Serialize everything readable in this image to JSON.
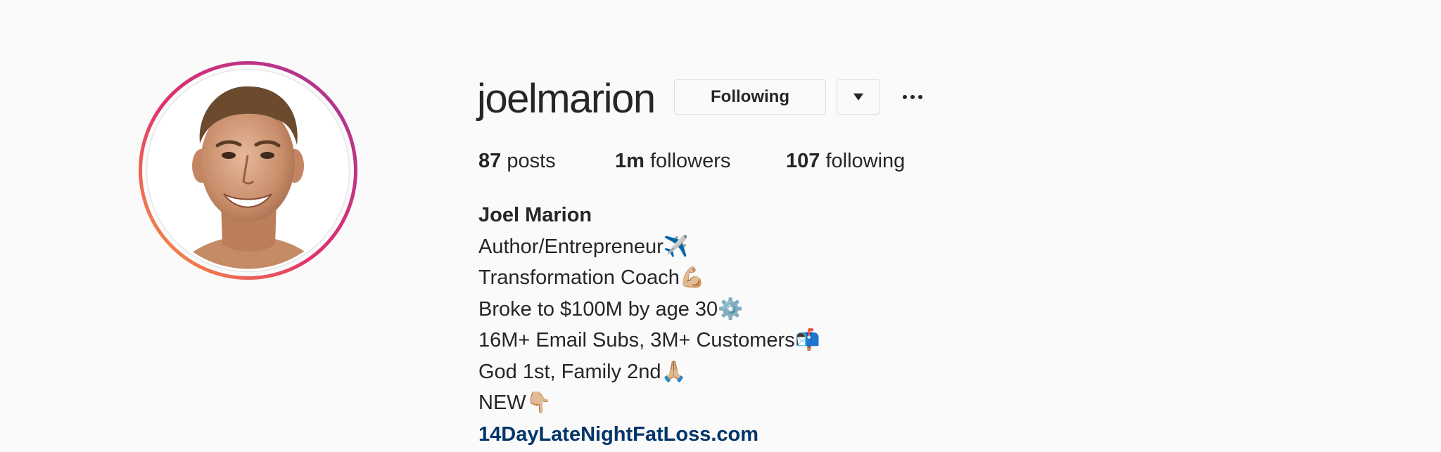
{
  "profile": {
    "username": "joelmarion",
    "avatar_icon": "profile-photo",
    "ring_colors": [
      "#f58529",
      "#dd2a7b",
      "#8134af"
    ]
  },
  "actions": {
    "following_label": "Following",
    "dropdown_icon": "caret-down-icon",
    "more_icon": "ellipsis-icon"
  },
  "stats": {
    "posts_count": "87",
    "posts_label": " posts",
    "followers_count": "1m",
    "followers_label": " followers",
    "following_count": "107",
    "following_label": " following"
  },
  "bio": {
    "full_name": "Joel Marion",
    "lines": [
      "Author/Entrepreneur✈️",
      "Transformation Coach💪🏼",
      "Broke to $100M by age 30⚙️",
      "16M+ Email Subs, 3M+ Customers📬",
      "God 1st, Family 2nd🙏🏼",
      "NEW👇🏼"
    ],
    "link": "14DayLateNightFatLoss.com"
  }
}
